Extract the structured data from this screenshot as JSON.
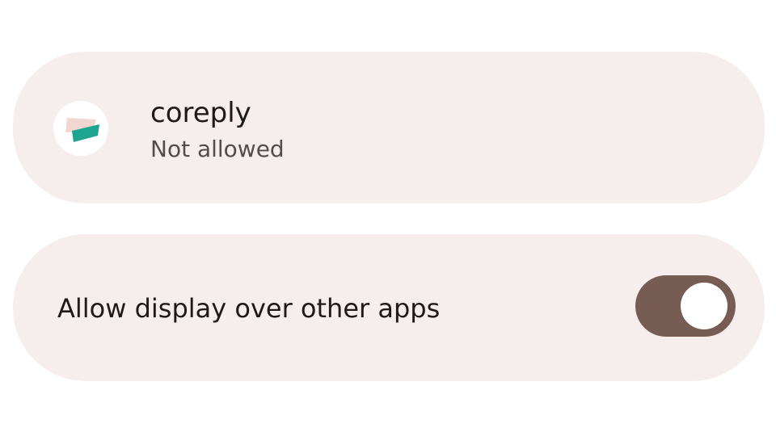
{
  "app_info": {
    "name": "coreply",
    "status": "Not allowed",
    "icon": "coreply-app-icon"
  },
  "overlay_permission": {
    "label": "Allow display over other apps",
    "enabled": true
  },
  "colors": {
    "card_background": "#f6eded",
    "switch_track": "#775c53",
    "switch_thumb": "#ffffff",
    "icon_accent_teal": "#1ea591",
    "icon_accent_pink": "#f1d6d1"
  }
}
